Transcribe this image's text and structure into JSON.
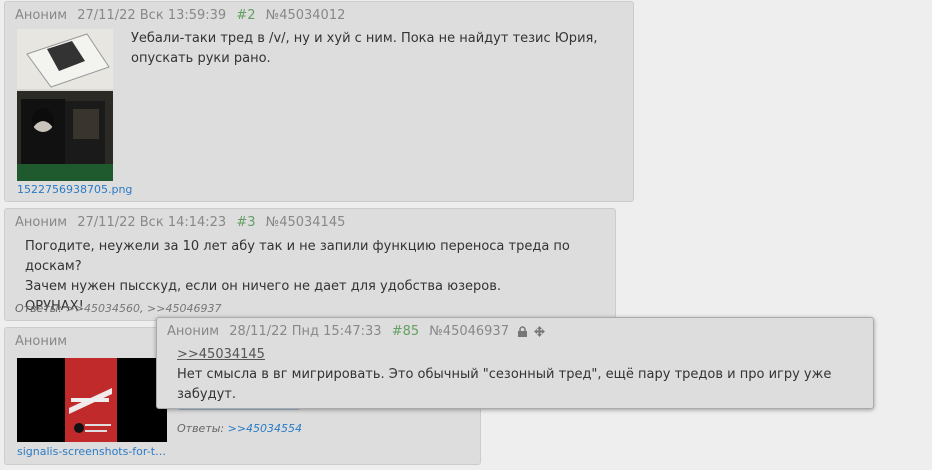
{
  "posts": [
    {
      "author": "Аноним",
      "date": "27/11/22 Вск 13:59:39",
      "num": "#2",
      "id": "№45034012",
      "lines": [
        "Уебали-таки тред в /v/, ну и хуй с ним. Пока не найдут тезис Юрия,",
        "опускать руки рано."
      ],
      "filename": "1522756938705.png"
    },
    {
      "author": "Аноним",
      "date": "27/11/22 Вск 14:14:23",
      "num": "#3",
      "id": "№45034145",
      "lines": [
        "Погодите, неужели за 10 лет абу так и не запили функцию переноса треда по доскам?",
        "Зачем нужен пысскуд, если он ничего не дает для удобства юзеров.",
        "ОРУНАХ!"
      ],
      "replies_label": "Ответы:",
      "replies": [
        ">>45034560",
        ">>45046937"
      ]
    },
    {
      "author": "Аноним",
      "filename": "signalis-screenshots-for-t…",
      "replies_label": "Ответы:",
      "replies": [
        ">>45034554"
      ]
    }
  ],
  "popup": {
    "author": "Аноним",
    "date": "28/11/22 Пнд 15:47:33",
    "num": "#85",
    "id": "№45046937",
    "reply_link": ">>45034145",
    "lines": [
      "Нет смысла в вг мигрировать. Это обычный \"сезонный тред\", ещё пару тредов и про игру уже",
      "забудут."
    ],
    "icons": [
      "lock-icon",
      "move-icon"
    ]
  },
  "colors": {
    "bg": "#eeeeee",
    "post_bg": "#dddddd",
    "num_green": "#64a064",
    "link_blue": "#2a7bc5"
  }
}
